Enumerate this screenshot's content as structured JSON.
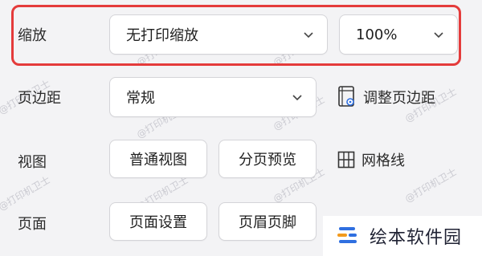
{
  "zoom": {
    "label": "缩放",
    "scale_mode_value": "无打印缩放",
    "percent_value": "100%"
  },
  "margins": {
    "label": "页边距",
    "value": "常规",
    "adjust_label": "调整页边距"
  },
  "view": {
    "label": "视图",
    "normal_label": "普通视图",
    "page_break_label": "分页预览",
    "gridlines_label": "网格线"
  },
  "page": {
    "label": "页面",
    "page_setup_label": "页面设置",
    "header_footer_label": "页眉页脚"
  },
  "watermark": {
    "text": "@打印机卫士"
  },
  "brand": {
    "name": "绘本软件园"
  },
  "colors": {
    "highlight": "#e43b3b",
    "brand_blue": "#2f6fe0",
    "brand_orange": "#f29a1d"
  }
}
